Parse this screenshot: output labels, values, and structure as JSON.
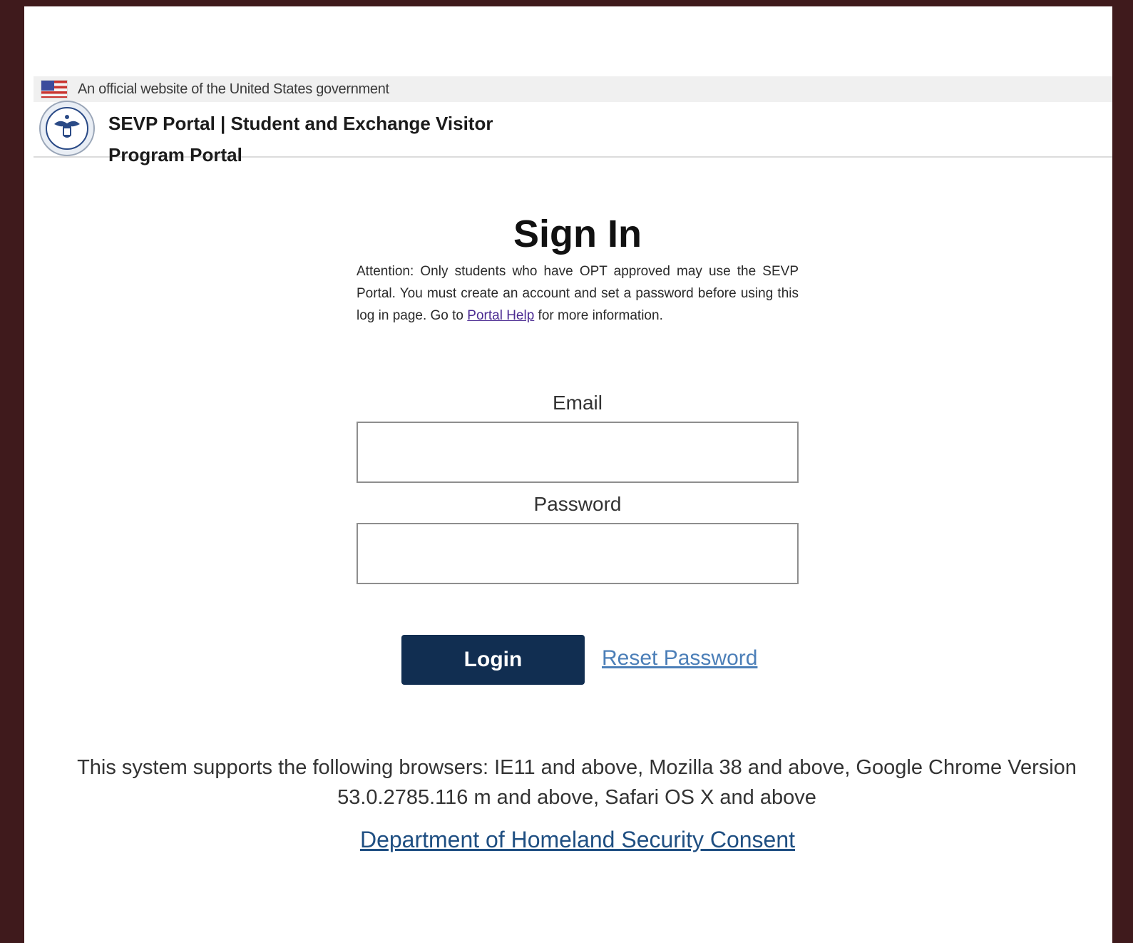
{
  "gov_banner": {
    "text": "An official website of the United States government",
    "flag_icon": "us-flag-icon"
  },
  "header": {
    "seal_icon": "dhs-seal-icon",
    "title": "SEVP Portal | Student and Exchange Visitor Program Portal"
  },
  "signin": {
    "title": "Sign In",
    "attention_before_link": "Attention: Only students who have OPT approved may use the SEVP Portal. You must create an account and set a password before using this log in page. Go to ",
    "help_link": "Portal Help",
    "attention_after_link": " for more information."
  },
  "form": {
    "email_label": "Email",
    "email_value": "",
    "password_label": "Password",
    "password_value": "",
    "login_button": "Login",
    "reset_link": "Reset Password"
  },
  "footer": {
    "browsers_text": "This system supports the following browsers: IE11 and above, Mozilla 38 and above, Google Chrome Version 53.0.2785.116 m and above, Safari OS X and above",
    "consent_link": "Department of Homeland Security Consent"
  },
  "colors": {
    "outer_background": "#3f1a1c",
    "login_button": "#112e51",
    "link": "#4c7fb8",
    "consent_link": "#1f4f82"
  }
}
